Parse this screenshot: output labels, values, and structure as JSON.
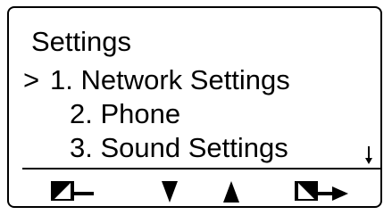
{
  "screen": {
    "title": "Settings",
    "cursor": ">",
    "items": [
      {
        "label": "1. Network Settings",
        "selected": true
      },
      {
        "label": "2. Phone",
        "selected": false
      },
      {
        "label": "3. Sound Settings",
        "selected": false
      }
    ],
    "scroll_indicator": "down-arrow-icon"
  },
  "softkeys": [
    {
      "icon": "back-icon"
    },
    {
      "icon": "down-triangle-icon"
    },
    {
      "icon": "up-triangle-icon"
    },
    {
      "icon": "enter-icon"
    }
  ],
  "colors": {
    "foreground": "#000000",
    "background": "#ffffff"
  }
}
